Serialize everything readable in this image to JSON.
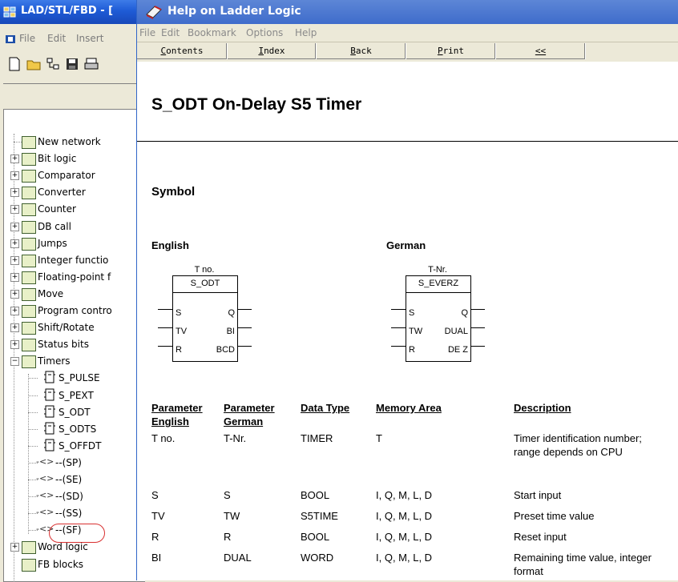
{
  "background_window": {
    "title": "LAD/STL/FBD  - [",
    "menu": [
      "File",
      "Edit",
      "Insert"
    ],
    "tree": {
      "items": [
        {
          "label": "New network",
          "icon": "new-network-icon",
          "expander": ""
        },
        {
          "label": "Bit logic",
          "icon": "bit-logic-icon",
          "expander": "+"
        },
        {
          "label": "Comparator",
          "icon": "comparator-icon",
          "expander": "+"
        },
        {
          "label": "Converter",
          "icon": "converter-icon",
          "expander": "+"
        },
        {
          "label": "Counter",
          "icon": "counter-icon",
          "expander": "+"
        },
        {
          "label": "DB call",
          "icon": "db-call-icon",
          "expander": "+"
        },
        {
          "label": "Jumps",
          "icon": "jumps-icon",
          "expander": "+"
        },
        {
          "label": "Integer functio",
          "icon": "integer-function-icon",
          "expander": "+"
        },
        {
          "label": "Floating-point f",
          "icon": "floating-point-icon",
          "expander": "+"
        },
        {
          "label": "Move",
          "icon": "move-icon",
          "expander": "+"
        },
        {
          "label": "Program contro",
          "icon": "program-control-icon",
          "expander": "+"
        },
        {
          "label": "Shift/Rotate",
          "icon": "shift-rotate-icon",
          "expander": "+"
        },
        {
          "label": "Status bits",
          "icon": "status-bits-icon",
          "expander": "+"
        },
        {
          "label": "Timers",
          "icon": "timers-icon",
          "expander": "−"
        }
      ],
      "timer_children": [
        "S_PULSE",
        "S_PEXT",
        "S_ODT",
        "S_ODTS",
        "S_OFFDT",
        "--(SP)",
        "--(SE)",
        "--(SD)",
        "--(SS)",
        "--(SF)"
      ],
      "after_items": [
        {
          "label": "Word logic",
          "icon": "word-logic-icon",
          "expander": "+"
        },
        {
          "label": "FB blocks",
          "icon": "fb-blocks-icon",
          "expander": ""
        }
      ],
      "selected": "S_ODT"
    }
  },
  "help_window": {
    "title": "Help on Ladder Logic",
    "menu": [
      "File",
      "Edit",
      "Bookmark",
      "Options",
      "Help"
    ],
    "buttons": [
      {
        "label": "Contents",
        "underline": "C"
      },
      {
        "label": "Index",
        "underline": "I"
      },
      {
        "label": "Back",
        "underline": "B"
      },
      {
        "label": "Print",
        "underline": "P"
      },
      {
        "label": "<<",
        "underline": "<<"
      }
    ],
    "page_title": "S_ODT  On-Delay S5 Timer",
    "symbol_heading": "Symbol",
    "english": {
      "heading": "English",
      "top_label": "T no.",
      "block_name": "S_ODT",
      "left_pins": [
        "S",
        "TV",
        "R"
      ],
      "right_pins": [
        "Q",
        "BI",
        "BCD"
      ]
    },
    "german": {
      "heading": "German",
      "top_label": "T-Nr.",
      "block_name": "S_EVERZ",
      "left_pins": [
        "S",
        "TW",
        "R"
      ],
      "right_pins": [
        "Q",
        "DUAL",
        "DE Z"
      ]
    },
    "table": {
      "headers": [
        "Parameter English",
        "Parameter German",
        "Data Type",
        "Memory Area",
        "Description"
      ],
      "rows": [
        [
          "T no.",
          "T-Nr.",
          "TIMER",
          "T",
          "Timer identification number; range depends on CPU"
        ],
        [
          "S",
          "S",
          "BOOL",
          "I, Q, M, L, D",
          "Start input"
        ],
        [
          "TV",
          "TW",
          "S5TIME",
          "I, Q, M, L, D",
          "Preset time value"
        ],
        [
          "R",
          "R",
          "BOOL",
          "I, Q, M, L, D",
          "Reset input"
        ],
        [
          "BI",
          "DUAL",
          "WORD",
          "I, Q, M, L, D",
          "Remaining time value, integer format"
        ]
      ]
    }
  }
}
